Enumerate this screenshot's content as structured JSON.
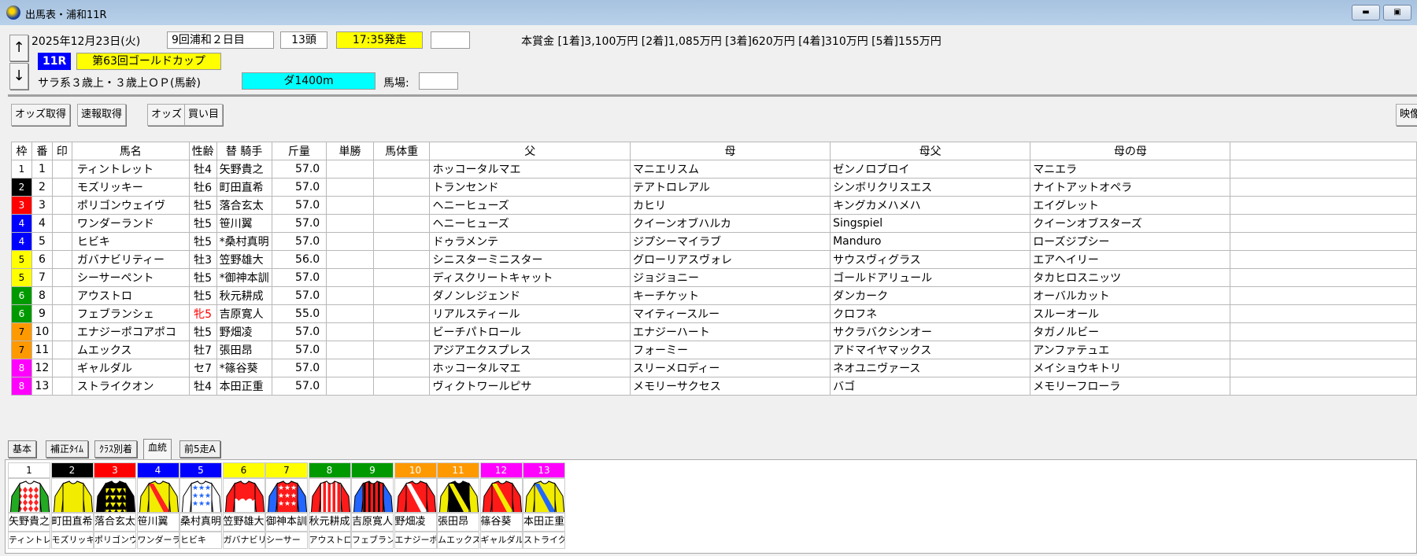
{
  "window": {
    "title": "出馬表・浦和11R",
    "minimize_icon": "minimize-icon",
    "maximize_icon": "maximize-icon"
  },
  "race": {
    "date": "2025年12月23日(火)",
    "meeting": "9回浦和２日目",
    "runners": "13頭",
    "post_time": "17:35発走",
    "extra_box": "",
    "race_no": "11R",
    "race_name": "第63回ゴールドカップ",
    "conditions": "サラ系３歳上・３歳上ＯＰ(馬齢)",
    "course": "ダ1400m",
    "track_label": "馬場:",
    "track_value": "",
    "prize": "本賞金 [1着]3,100万円 [2着]1,085万円 [3着]620万円 [4着]310万円 [5着]155万円",
    "up_arrow": "↑",
    "down_arrow": "↓"
  },
  "toolbar": {
    "odds_fetch": "オッズ取得",
    "flash_fetch": "速報取得",
    "odds": "オッズ",
    "bets": "買い目",
    "video": "映像表"
  },
  "colors": {
    "frame": {
      "1": "#ffffff",
      "2": "#000000",
      "3": "#ff0000",
      "4": "#0000ff",
      "5": "#ffff00",
      "6": "#009900",
      "7": "#ff9900",
      "8": "#ff00ff"
    },
    "post_time_bg": "#ffff00",
    "race_no_bg": "#0000ff",
    "course_bg": "#00ffff",
    "female": "#ff0000"
  },
  "table": {
    "headers": [
      "枠",
      "番",
      "印",
      "馬名",
      "性齢",
      "替 騎手",
      "斤量",
      "単勝",
      "馬体重",
      "父",
      "母",
      "母父",
      "母の母"
    ],
    "rows": [
      {
        "frame": "1",
        "no": "1",
        "mark": "",
        "name": "ティントレット",
        "sexage": "牡4",
        "jockey": " 矢野貴之",
        "weight": "57.0",
        "win": "",
        "bw": "",
        "sire": "ホッコータルマエ",
        "dam": "マニエリスム",
        "damsire": "ゼンノロブロイ",
        "damdam": "マニエラ"
      },
      {
        "frame": "2",
        "no": "2",
        "mark": "",
        "name": "モズリッキー",
        "sexage": "牡6",
        "jockey": " 町田直希",
        "weight": "57.0",
        "win": "",
        "bw": "",
        "sire": "トランセンド",
        "dam": "テアトロレアル",
        "damsire": "シンボリクリスエス",
        "damdam": "ナイトアットオペラ"
      },
      {
        "frame": "3",
        "no": "3",
        "mark": "",
        "name": "ポリゴンウェイヴ",
        "sexage": "牡5",
        "jockey": " 落合玄太",
        "weight": "57.0",
        "win": "",
        "bw": "",
        "sire": "ヘニーヒューズ",
        "dam": "カヒリ",
        "damsire": "キングカメハメハ",
        "damdam": "エイグレット"
      },
      {
        "frame": "4",
        "no": "4",
        "mark": "",
        "name": "ワンダーランド",
        "sexage": "牡5",
        "jockey": " 笹川翼",
        "weight": "57.0",
        "win": "",
        "bw": "",
        "sire": "ヘニーヒューズ",
        "dam": "クイーンオブハルカ",
        "damsire": "Singspiel",
        "damdam": "クイーンオブスターズ"
      },
      {
        "frame": "4",
        "no": "5",
        "mark": "",
        "name": "ヒビキ",
        "sexage": "牡5",
        "jockey": "*桑村真明",
        "weight": "57.0",
        "win": "",
        "bw": "",
        "sire": "ドゥラメンテ",
        "dam": "ジプシーマイラブ",
        "damsire": "Manduro",
        "damdam": "ローズジプシー"
      },
      {
        "frame": "5",
        "no": "6",
        "mark": "",
        "name": "ガバナビリティー",
        "sexage": "牡3",
        "jockey": " 笠野雄大",
        "weight": "56.0",
        "win": "",
        "bw": "",
        "sire": "シニスターミニスター",
        "dam": "グローリアスヴォレ",
        "damsire": "サウスヴィグラス",
        "damdam": "エアヘイリー"
      },
      {
        "frame": "5",
        "no": "7",
        "mark": "",
        "name": "シーサーペント",
        "sexage": "牡5",
        "jockey": "*御神本訓",
        "weight": "57.0",
        "win": "",
        "bw": "",
        "sire": "ディスクリートキャット",
        "dam": "ジョジョニー",
        "damsire": "ゴールドアリュール",
        "damdam": "タカヒロスニッツ"
      },
      {
        "frame": "6",
        "no": "8",
        "mark": "",
        "name": "アウストロ",
        "sexage": "牡5",
        "jockey": " 秋元耕成",
        "weight": "57.0",
        "win": "",
        "bw": "",
        "sire": "ダノンレジェンド",
        "dam": "キーチケット",
        "damsire": "ダンカーク",
        "damdam": "オーバルカット"
      },
      {
        "frame": "6",
        "no": "9",
        "mark": "",
        "name": "フェブランシェ",
        "sexage": "牝5",
        "female": true,
        "jockey": " 吉原寛人",
        "weight": "55.0",
        "win": "",
        "bw": "",
        "sire": "リアルスティール",
        "dam": "マイティースルー",
        "damsire": "クロフネ",
        "damdam": "スルーオール"
      },
      {
        "frame": "7",
        "no": "10",
        "mark": "",
        "name": "エナジーポコアポコ",
        "sexage": "牡5",
        "jockey": " 野畑凌",
        "weight": "57.0",
        "win": "",
        "bw": "",
        "sire": "ビーチパトロール",
        "dam": "エナジーハート",
        "damsire": "サクラバクシンオー",
        "damdam": "タガノルビー"
      },
      {
        "frame": "7",
        "no": "11",
        "mark": "",
        "name": "ムエックス",
        "sexage": "牡7",
        "jockey": " 張田昂",
        "weight": "57.0",
        "win": "",
        "bw": "",
        "sire": "アジアエクスプレス",
        "dam": "フォーミー",
        "damsire": "アドマイヤマックス",
        "damdam": "アンファテュエ"
      },
      {
        "frame": "8",
        "no": "12",
        "mark": "",
        "name": "ギャルダル",
        "sexage": "セ7",
        "jockey": "*篠谷葵",
        "weight": "57.0",
        "win": "",
        "bw": "",
        "sire": "ホッコータルマエ",
        "dam": "スリーメロディー",
        "damsire": "ネオユニヴァース",
        "damdam": "メイショウキトリ"
      },
      {
        "frame": "8",
        "no": "13",
        "mark": "",
        "name": "ストライクオン",
        "sexage": "牡4",
        "jockey": " 本田正重",
        "weight": "57.0",
        "win": "",
        "bw": "",
        "sire": "ヴィクトワールピサ",
        "dam": "メモリーサクセス",
        "damsire": "バゴ",
        "damdam": "メモリーフローラ"
      }
    ]
  },
  "tabs": [
    {
      "label": "基本"
    },
    {
      "label": "補正ﾀｲﾑ"
    },
    {
      "label": "ｸﾗｽ別着"
    },
    {
      "label": "血統",
      "active": true
    },
    {
      "label": "前5走A"
    }
  ],
  "silks": [
    {
      "no": "1",
      "jockey": "矢野貴之",
      "horse": "ティントレ",
      "body": "#ffffff",
      "sleeve": "#22aa22",
      "pattern": "diamonds",
      "accent": "#ff2222"
    },
    {
      "no": "2",
      "jockey": "町田直希",
      "horse": "モズリッキ",
      "body": "#f2ec00",
      "sleeve": "#f2ec00",
      "pattern": "plain",
      "accent": "#f2ec00"
    },
    {
      "no": "3",
      "jockey": "落合玄太",
      "horse": "ポリゴンウ",
      "body": "#000000",
      "sleeve": "#000000",
      "pattern": "triangles",
      "accent": "#f2ec00"
    },
    {
      "no": "4",
      "jockey": "笹川翼",
      "horse": "ワンダーラ",
      "body": "#f2ec00",
      "sleeve": "#f2ec00",
      "pattern": "sash",
      "accent": "#ff2222"
    },
    {
      "no": "5",
      "jockey": "桑村真明",
      "horse": "ヒビキ",
      "body": "#ffffff",
      "sleeve": "#ffffff",
      "pattern": "stars",
      "accent": "#2266ff"
    },
    {
      "no": "6",
      "jockey": "笠野雄大",
      "horse": "ガバナビリ",
      "body": "#ff1a1a",
      "sleeve": "#ff1a1a",
      "pattern": "whitebottom",
      "accent": "#ffffff"
    },
    {
      "no": "7",
      "jockey": "御神本訓",
      "horse": "シーサー",
      "body": "#ff1a1a",
      "sleeve": "#2266ff",
      "pattern": "stars",
      "accent": "#ffffff"
    },
    {
      "no": "8",
      "jockey": "秋元耕成",
      "horse": "アウストロ",
      "body": "#ff1a1a",
      "sleeve": "#ff1a1a",
      "pattern": "stripes",
      "accent": "#ffffff"
    },
    {
      "no": "9",
      "jockey": "吉原寛人",
      "horse": "フェブラン",
      "body": "#ff1a1a",
      "sleeve": "#2266ff",
      "pattern": "stripes",
      "accent": "#000000"
    },
    {
      "no": "10",
      "jockey": "野畑凌",
      "horse": "エナジーポ",
      "body": "#ff1a1a",
      "sleeve": "#ff1a1a",
      "pattern": "sash",
      "accent": "#ffffff"
    },
    {
      "no": "11",
      "jockey": "張田昂",
      "horse": "ムエックス",
      "body": "#000000",
      "sleeve": "#f2ec00",
      "pattern": "sash",
      "accent": "#f2ec00"
    },
    {
      "no": "12",
      "jockey": "篠谷葵",
      "horse": "ギャルダル",
      "body": "#ff1a1a",
      "sleeve": "#ff1a1a",
      "pattern": "sash",
      "accent": "#f2ec00"
    },
    {
      "no": "13",
      "jockey": "本田正重",
      "horse": "ストライク",
      "body": "#f2ec00",
      "sleeve": "#f2ec00",
      "pattern": "sash",
      "accent": "#2266ff"
    }
  ]
}
